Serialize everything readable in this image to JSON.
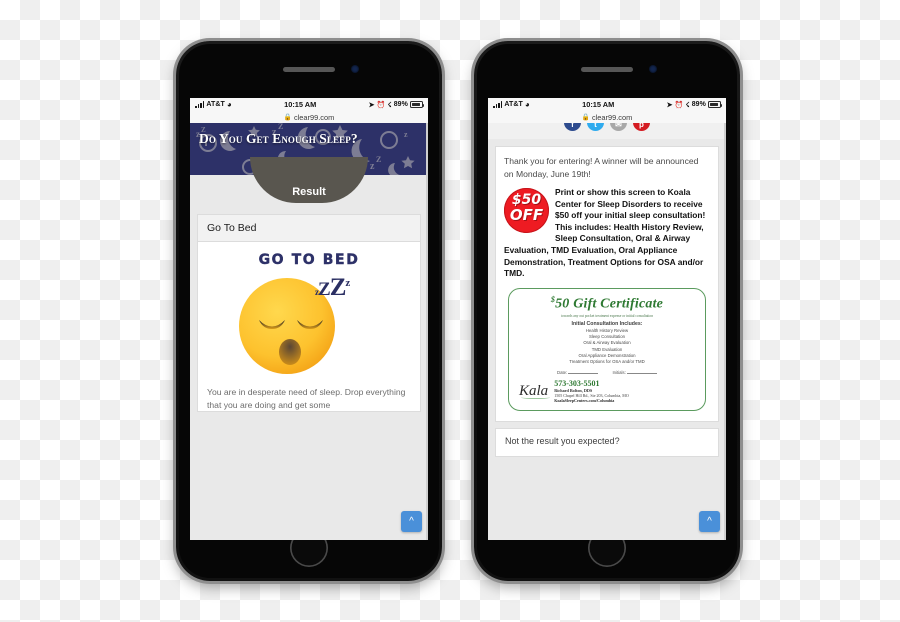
{
  "background": {
    "checker_light": "#ffffff",
    "checker_dark": "#efefef"
  },
  "phones": [
    {
      "id": "left-phone",
      "statusbar": {
        "carrier": "AT&T",
        "time": "10:15 AM",
        "battery": "89%",
        "wifi_icon": "wifi-icon",
        "location_icon": "location-arrow-icon",
        "alarm_icon": "alarm-icon",
        "bluetooth_icon": "bluetooth-icon"
      },
      "urlbar": {
        "lock_icon": "lock-icon",
        "url": "clear99.com"
      },
      "hero": {
        "title": "Do You Get Enough Sleep?",
        "bg_color": "#2d3168",
        "pattern_color": "#9b9aa8"
      },
      "result_band": {
        "label": "Result",
        "color": "#59564f"
      },
      "card": {
        "heading": "Go To Bed",
        "art_title": "GO TO BED",
        "zzz": [
          "z",
          "Z",
          "Z",
          "z"
        ],
        "emoji": "sleepy-face-emoji",
        "art_color": "#2d3168"
      },
      "body_text": "You are in desperate need of sleep. Drop everything that you are doing and get some",
      "to_top": {
        "icon": "chevron-up-icon",
        "color": "#4a90d9"
      }
    },
    {
      "id": "right-phone",
      "statusbar": {
        "carrier": "AT&T",
        "time": "10:15 AM",
        "battery": "89%"
      },
      "urlbar": {
        "lock_icon": "lock-icon",
        "url": "clear99.com"
      },
      "social_buttons": [
        {
          "name": "facebook-share-button",
          "glyph": "f",
          "color": "#2d4b8e"
        },
        {
          "name": "twitter-share-button",
          "glyph": "t",
          "color": "#2fabee"
        },
        {
          "name": "email-share-button",
          "glyph": "✉",
          "color": "#a8a8a8"
        },
        {
          "name": "pinterest-share-button",
          "glyph": "p",
          "color": "#d41b22"
        }
      ],
      "thanks": "Thank you for entering! A winner will be announced on Monday, June 19th!",
      "badge": {
        "amount": "$50",
        "word": "OFF",
        "color": "#ee1b22"
      },
      "coupon_text": "Print or show this screen to Koala Center for Sleep Disorders to receive $50 off your initial sleep consultation! This includes: Health History Review, Sleep Consultation, Oral & Airway Evaluation, TMD Evaluation, Oral Appliance Demonstration, Treatment Options for OSA and/or TMD.",
      "gift_certificate": {
        "currency": "$",
        "title": "50 Gift Certificate",
        "subtitle": "towards any out pocket treatment expense or initial consultation",
        "includes_heading": "Initial Consultation Includes:",
        "includes": [
          "Health History Review",
          "Sleep Consultation",
          "Oral & Airway Evaluation",
          "TMD Evaluation",
          "Oral Appliance Demonstration",
          "Treatment Options for OSA and/or TMD"
        ],
        "date_label": "Date:",
        "initials_label": "Initials:",
        "logo_text": "Kala",
        "phone": "573-303-5501",
        "doctor": "Richard Bolton, DDS",
        "address": "1505 Chapel Hill Rd., Ste 203, Columbia, MO",
        "website": "KoalaSleepCenters.com/Columbia",
        "border_color": "#5b9b5e",
        "title_color": "#2f7a33"
      },
      "not_expected": "Not the result you expected?",
      "to_top": {
        "icon": "chevron-up-icon",
        "color": "#4a90d9"
      }
    }
  ]
}
